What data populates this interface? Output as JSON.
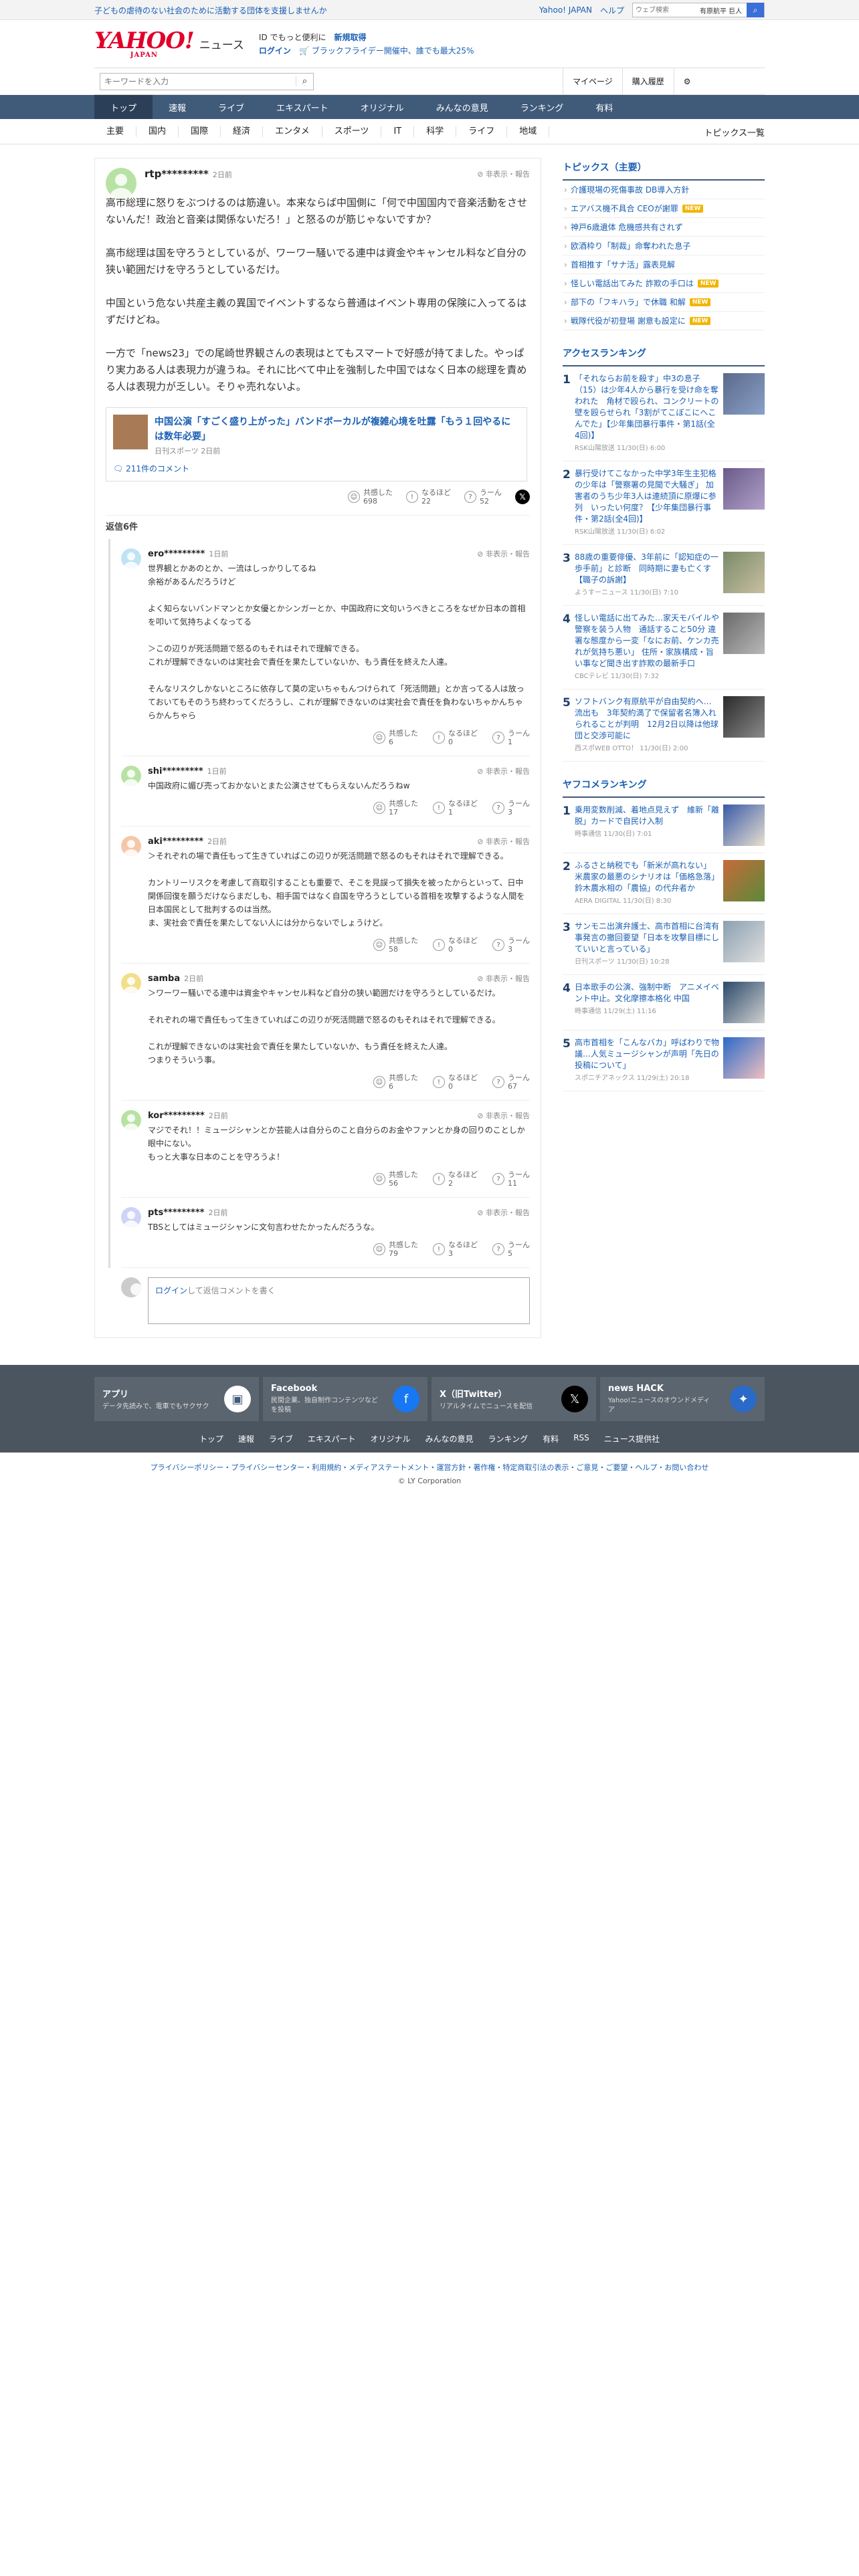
{
  "topbar": {
    "promo": "子どもの虐待のない社会のために活動する団体を支援しませんか",
    "yahoo_japan": "Yahoo! JAPAN",
    "help": "ヘルプ",
    "search_placeholder": "ウェブ検索",
    "search_query": "有原航平 巨人"
  },
  "header": {
    "logo": "YAHOO!",
    "logo_sub": "JAPAN",
    "site": "ニュース",
    "tagline_pre": "ID でもっと便利に",
    "tagline_link": "新規取得",
    "login": "ログイン",
    "promo": "ブラックフライデー開催中、誰でも最大25%"
  },
  "searchrow": {
    "placeholder": "キーワードを入力",
    "mypage": "マイページ",
    "history": "購入履歴"
  },
  "nav": [
    "トップ",
    "速報",
    "ライブ",
    "エキスパート",
    "オリジナル",
    "みんなの意見",
    "ランキング",
    "有料"
  ],
  "subnav": {
    "cats": [
      "主要",
      "国内",
      "国際",
      "経済",
      "エンタメ",
      "スポーツ",
      "IT",
      "科学",
      "ライフ",
      "地域"
    ],
    "all": "トピックス一覧"
  },
  "main_comment": {
    "user": "rtp*********",
    "time": "2日前",
    "flag": "非表示・報告",
    "text": "高市総理に怒りをぶつけるのは筋違い。本来ならば中国側に「何で中国国内で音楽活動をさせないんだ！政治と音楽は関係ないだろ！」と怒るのが筋じゃないですか？\n\n高市総理は国を守ろうとしているが、ワーワー騒いでる連中は資金やキャンセル料など自分の狭い範囲だけを守ろうとしているだけ。\n\n中国という危ない共産主義の異国でイベントするなら普通はイベント専用の保険に入ってるはずだけどね。\n\n一方で「news23」での尾崎世界観さんの表現はとてもスマートで好感が持てました。やっぱり実力ある人は表現力が違うね。それに比べて中止を強制した中国ではなく日本の総理を責める人は表現力が乏しい。そりゃ売れないよ。",
    "article_title": "中国公演「すごく盛り上がった」バンドボーカルが複雑心境を吐露「もう１回やるには数年必要」",
    "article_source": "日刊スポーツ 2日前",
    "comment_count": "211件のコメント",
    "reactions": {
      "agree_label": "共感した",
      "agree": "698",
      "insight_label": "なるほど",
      "insight": "22",
      "hmm_label": "うーん",
      "hmm": "52"
    }
  },
  "replies_header": "返信6件",
  "replies": [
    {
      "user": "ero*********",
      "time": "1日前",
      "flag": "非表示・報告",
      "text": "世界観とかあのとか、一流はしっかりしてるね\n余裕があるんだろうけど\n\nよく知らないバンドマンとか女優とかシンガーとか、中国政府に文句いうべきところをなぜか日本の首相を叩いて気持ちよくなってる\n\n＞この辺りが死活問題で怒るのもそれはそれで理解できる。\nこれが理解できないのは実社会で責任を果たしていないか、もう責任を終えた人達。\n\nそんなリスクしかないところに依存して莫の定いちゃもんつけられて「死活問題」とか言ってる人は放っておいてもそのうち終わってくだろうし、これが理解できないのは実社会で責任を負わないちゃかんちゃらかんちゃら",
      "agree": "6",
      "insight": "0",
      "hmm": "1"
    },
    {
      "user": "shi*********",
      "time": "1日前",
      "flag": "非表示・報告",
      "text": "中国政府に媚び売っておかないとまた公演させてもらえないんだろうねw",
      "agree": "17",
      "insight": "1",
      "hmm": "3"
    },
    {
      "user": "aki*********",
      "time": "2日前",
      "flag": "非表示・報告",
      "text": "＞それぞれの場で責任もって生きていればこの辺りが死活問題で怒るのもそれはそれで理解できる。\n\nカントリーリスクを考慮して商取引することも重要で、そこを見誤って損失を被ったからといって、日中関係回復を願うだけならまだしも、相手国ではなく自国を守ろうとしている首相を攻撃するような人間を日本国民として批判するのは当然。\nま、実社会で責任を果たしてない人には分からないでしょうけど。",
      "agree": "58",
      "insight": "0",
      "hmm": "3"
    },
    {
      "user": "samba",
      "time": "2日前",
      "flag": "非表示・報告",
      "text": "＞ワーワー騒いでる連中は資金やキャンセル料など自分の狭い範囲だけを守ろうとしているだけ。\n\nそれぞれの場で責任もって生きていればこの辺りが死活問題で怒るのもそれはそれで理解できる。\n\nこれが理解できないのは実社会で責任を果たしていないか、もう責任を終えた人達。\nつまりそういう事。",
      "agree": "6",
      "insight": "0",
      "hmm": "67"
    },
    {
      "user": "kor*********",
      "time": "2日前",
      "flag": "非表示・報告",
      "text": "マジでそれ！！ミュージシャンとか芸能人は自分らのこと自分らのお金やファンとか身の回りのことしか眼中にない。\nもっと大事な日本のことを守ろうよ！",
      "agree": "56",
      "insight": "2",
      "hmm": "11"
    },
    {
      "user": "pts*********",
      "time": "2日前",
      "flag": "非表示・報告",
      "text": "TBSとしてはミュージシャンに文句言わせたかったんだろうな。",
      "agree": "79",
      "insight": "3",
      "hmm": "5"
    }
  ],
  "replybox": {
    "login": "ログイン",
    "text": "して返信コメントを書く"
  },
  "sidebar": {
    "topics_title": "トピックス（主要）",
    "topics": [
      {
        "t": "介護現場の死傷事故 DB導入方針",
        "b": ""
      },
      {
        "t": "エアバス機不具合 CEOが謝罪",
        "b": "NEW"
      },
      {
        "t": "神戸6歳遺体 危機感共有されず",
        "b": ""
      },
      {
        "t": "欧酒枠り「制裁」命奪われた息子",
        "b": ""
      },
      {
        "t": "首相推す「サナ活」露表見解",
        "b": ""
      },
      {
        "t": "怪しい電話出てみた 詐欺の手口は",
        "b": "NEW"
      },
      {
        "t": "部下の「フキハラ」で休職 和解",
        "b": "NEW"
      },
      {
        "t": "戦隊代役が初登場 謝意も設定に",
        "b": "NEW"
      }
    ],
    "access_title": "アクセスランキング",
    "access": [
      {
        "n": "1",
        "t": "「それならお前を殺す」中3の息子（15）は少年4人から暴行を受け命を奪われた　角材で殴られ、コンクリートの壁を殴らせられ「3割がてこぼこにへこんでた」【少年集団暴行事件・第1話(全4回)】",
        "s": "RSK山陽放送 11/30(日) 6:00"
      },
      {
        "n": "2",
        "t": "暴行受けてこなかった中学3年生主犯格の少年は「警察署の見聞で大騒ぎ」 加害者のうち少年3人は連続頂に原爆に参列　いったい何度？【少年集団暴行事件・第2話(全4回)】",
        "s": "RSK山陽放送 11/30(日) 6:02"
      },
      {
        "n": "3",
        "t": "88歳の重要俳優、3年前に「認知症の一歩手前」と診断　同時期に妻も亡くす【職子の訴謝】",
        "s": "ようすーニュース 11/30(日) 7:10"
      },
      {
        "n": "4",
        "t": "怪しい電話に出てみた…家天モバイルや警察を装う人物　通話すること50分 違署な態度から一変「なにお前、ケンカ売れが気持ち悪い」 住所・家族構成・旨い事など聞き出す詐欺の最新手口",
        "s": "CBCテレビ 11/30(日) 7:32"
      },
      {
        "n": "5",
        "t": "ソフトバンク有原航平が自由契約へ…流出も　3年契約満了で保留者名簿入れられることが判明　12月2日以降は他球団と交渉可能に",
        "s": "西スポWEB OTTO！ 11/30(日) 2:00"
      }
    ],
    "yafoo_title": "ヤフコメランキング",
    "yafoo": [
      {
        "n": "1",
        "t": "乗用変数削減、着地点見えず　維新「離脱」カードで自民け入制",
        "s": "時事通信 11/30(日) 7:01"
      },
      {
        "n": "2",
        "t": "ふるさと納税でも「新米が高れない」 米農家の最悪のシナリオは「価格急落」 鈴木農水相の「農協」の代弁者か",
        "s": "AERA DIGITAL 11/30(日) 8:30"
      },
      {
        "n": "3",
        "t": "サンモニ出演弁護士、高市首相に台湾有事発言の撤回要望「日本を攻撃目標にしていいと言っている」",
        "s": "日刊スポーツ 11/30(日) 10:28"
      },
      {
        "n": "4",
        "t": "日本歌手の公演、強制中断　アニメイベント中止。文化摩擦本格化 中国",
        "s": "時事通信 11/29(土) 11:16"
      },
      {
        "n": "5",
        "t": "高市首相を「こんなバカ」呼ばわりで物議…人気ミュージシャンが声明「先日の投稿について」",
        "s": "スポニチアネックス 11/29(土) 20:18"
      }
    ]
  },
  "footer": {
    "apps": [
      {
        "title": "アプリ",
        "desc": "データ先読みで、電車でもサクサク",
        "icon": "app-icon"
      },
      {
        "title": "Facebook",
        "desc": "民間企業、独自制作コンテンツなどを投稿",
        "icon": "facebook-icon"
      },
      {
        "title": "X（旧Twitter）",
        "desc": "リアルタイムでニュースを配信",
        "icon": "x-icon"
      },
      {
        "title": "news HACK",
        "desc": "Yahoo!ニュースのオウンドメディア",
        "icon": "newshack-icon"
      }
    ],
    "links": [
      "トップ",
      "速報",
      "ライブ",
      "エキスパート",
      "オリジナル",
      "みんなの意見",
      "ランキング",
      "有料",
      "RSS",
      "ニュース提供社"
    ],
    "legal": "プライバシーポリシー・プライバシーセンター・利用規約・メディアステートメント・運営方針・著作権・特定商取引法の表示・ご意見・ご要望・ヘルプ・お問い合わせ",
    "copyright": "© LY Corporation"
  }
}
